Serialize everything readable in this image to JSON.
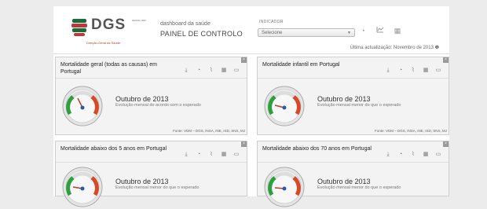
{
  "header": {
    "logo_text": "DGS",
    "logo_sub": "Direção-Geral da Saúde",
    "logo_small": "DESDE 1899",
    "dash_small": "dashboard da saúde",
    "dash_title": "PAINEL DE CONTROLO",
    "select_label": "INDICADOR",
    "select_value": "Selecione",
    "last_update": "Última actualização: Novembro de 2013"
  },
  "panels": [
    {
      "title": "Mortalidade geral (todas as causas) em Portugal",
      "month": "Outubro de 2013",
      "desc": "Evolução mensal de acordo com o esperado",
      "source": "Fonte: VDM – DGS, INSA, INE, ISD, SNS, MJ"
    },
    {
      "title": "Mortalidade infantil em Portugal",
      "month": "Outubro de 2013",
      "desc": "Evolução mensal menor do que o esperado",
      "source": "Fonte: VDM – DGS, INSA, INE, ISD, SNS, MJ"
    },
    {
      "title": "Mortalidade abaixo dos 5 anos em Portugal",
      "month": "Outubro de 2013",
      "desc": "Evolução mensal menor do que o esperado",
      "source": ""
    },
    {
      "title": "Mortalidade abaixo dos 70 anos em Portugal",
      "month": "Outubro de 2013",
      "desc": "Evolução mensal menor do que o esperado",
      "source": ""
    }
  ],
  "colors": {
    "good": "#2e9e3e",
    "bad": "#d64a2a",
    "needle": "#c0392b",
    "hub": "#2c5aa0"
  },
  "icons": [
    "download-icon",
    "clock-icon",
    "line-chart-icon",
    "table-icon",
    "comment-icon"
  ]
}
